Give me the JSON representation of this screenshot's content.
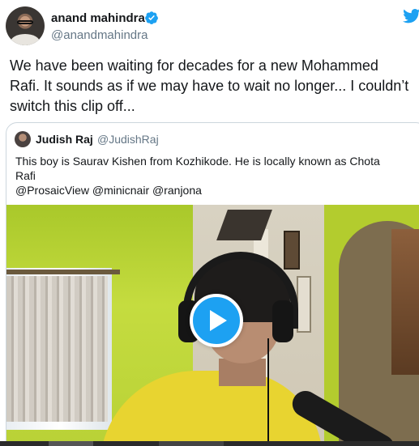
{
  "author": {
    "name": "anand mahindra",
    "handle": "@anandmahindra",
    "verified": true
  },
  "tweet": {
    "lines": [
      "We have been waiting for decades for a new Mohammed",
      "Rafi. It sounds as if we may have to wait no longer... I couldn’t",
      "switch this clip off..."
    ]
  },
  "quoted_tweet": {
    "name": "Judish Raj",
    "handle": "@JudishRaj",
    "lines": [
      "This boy is Saurav Kishen from Kozhikode. He is locally known as Chota",
      "Rafi",
      "@ProsaicView @minicnair @ranjona"
    ]
  },
  "icons": {
    "verified": "verified-badge-icon",
    "brand": "twitter-bird-icon",
    "play": "play-icon"
  },
  "colors": {
    "brand_blue": "#1da1f2",
    "text": "#14171a",
    "secondary_text": "#657786",
    "border": "#ccd6dd"
  }
}
